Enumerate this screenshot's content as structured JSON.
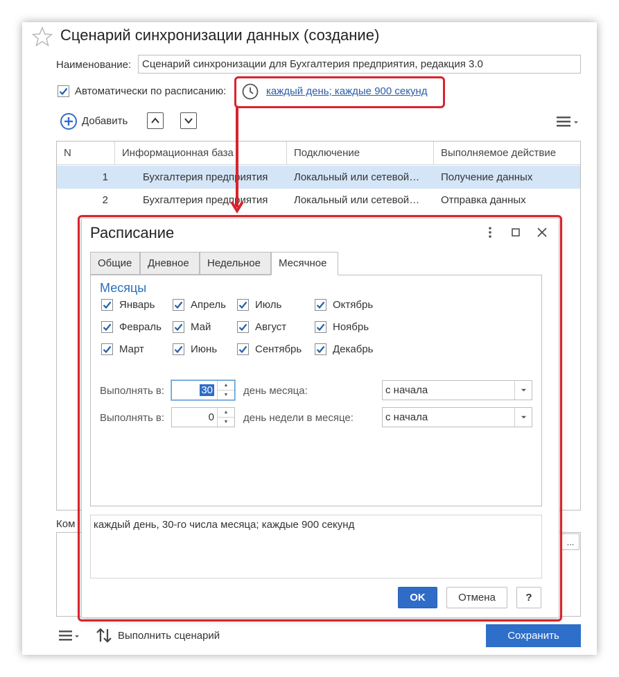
{
  "window": {
    "title": "Сценарий синхронизации данных (создание)"
  },
  "form": {
    "name_label": "Наименование:",
    "name_value": "Сценарий синхронизации для Бухгалтерия предприятия, редакция 3.0",
    "auto_schedule_label": "Автоматически по расписанию:",
    "auto_schedule_checked": true,
    "schedule_link": "каждый день; каждые 900 секунд",
    "comment_label": "Ком",
    "comment_button": "..."
  },
  "toolbar": {
    "add_label": "Добавить",
    "icons": [
      "add-circle-icon",
      "arrow-up-icon",
      "arrow-down-icon",
      "menu-icon"
    ]
  },
  "table": {
    "columns": [
      "N",
      "Информационная база",
      "Подключение",
      "Выполняемое действие"
    ],
    "rows": [
      {
        "n": "1",
        "base": "Бухгалтерия предприятия",
        "connection": "Локальный или сетевой каталог",
        "action": "Получение данных",
        "selected": true
      },
      {
        "n": "2",
        "base": "Бухгалтерия предприятия",
        "connection": "Локальный или сетевой каталог",
        "action": "Отправка данных",
        "selected": false
      }
    ]
  },
  "footer": {
    "run_label": "Выполнить сценарий",
    "save_label": "Сохранить"
  },
  "dialog": {
    "title": "Расписание",
    "tabs": [
      {
        "label": "Общие",
        "active": false
      },
      {
        "label": "Дневное",
        "active": false
      },
      {
        "label": "Недельное",
        "active": false
      },
      {
        "label": "Месячное",
        "active": true
      }
    ],
    "months_title": "Месяцы",
    "months": [
      {
        "label": "Январь",
        "checked": true
      },
      {
        "label": "Апрель",
        "checked": true
      },
      {
        "label": "Июль",
        "checked": true
      },
      {
        "label": "Октябрь",
        "checked": true
      },
      {
        "label": "Февраль",
        "checked": true
      },
      {
        "label": "Май",
        "checked": true
      },
      {
        "label": "Август",
        "checked": true
      },
      {
        "label": "Ноябрь",
        "checked": true
      },
      {
        "label": "Март",
        "checked": true
      },
      {
        "label": "Июнь",
        "checked": true
      },
      {
        "label": "Сентябрь",
        "checked": true
      },
      {
        "label": "Декабрь",
        "checked": true
      }
    ],
    "run_at_label": "Выполнять в:",
    "day_of_month_value": "30",
    "day_of_month_label": "день месяца:",
    "day_of_month_option": "с начала",
    "day_of_week_value": "0",
    "day_of_week_label": "день недели в месяце:",
    "day_of_week_option": "с начала",
    "summary": "каждый день, 30-го числа месяца; каждые 900 секунд",
    "ok_label": "OK",
    "cancel_label": "Отмена",
    "help_label": "?"
  },
  "colors": {
    "accent": "#2f6cc8",
    "link": "#2c5ea8",
    "selection": "#d4e5f8",
    "callout": "#d9232e",
    "section_title": "#2a6ebb"
  }
}
